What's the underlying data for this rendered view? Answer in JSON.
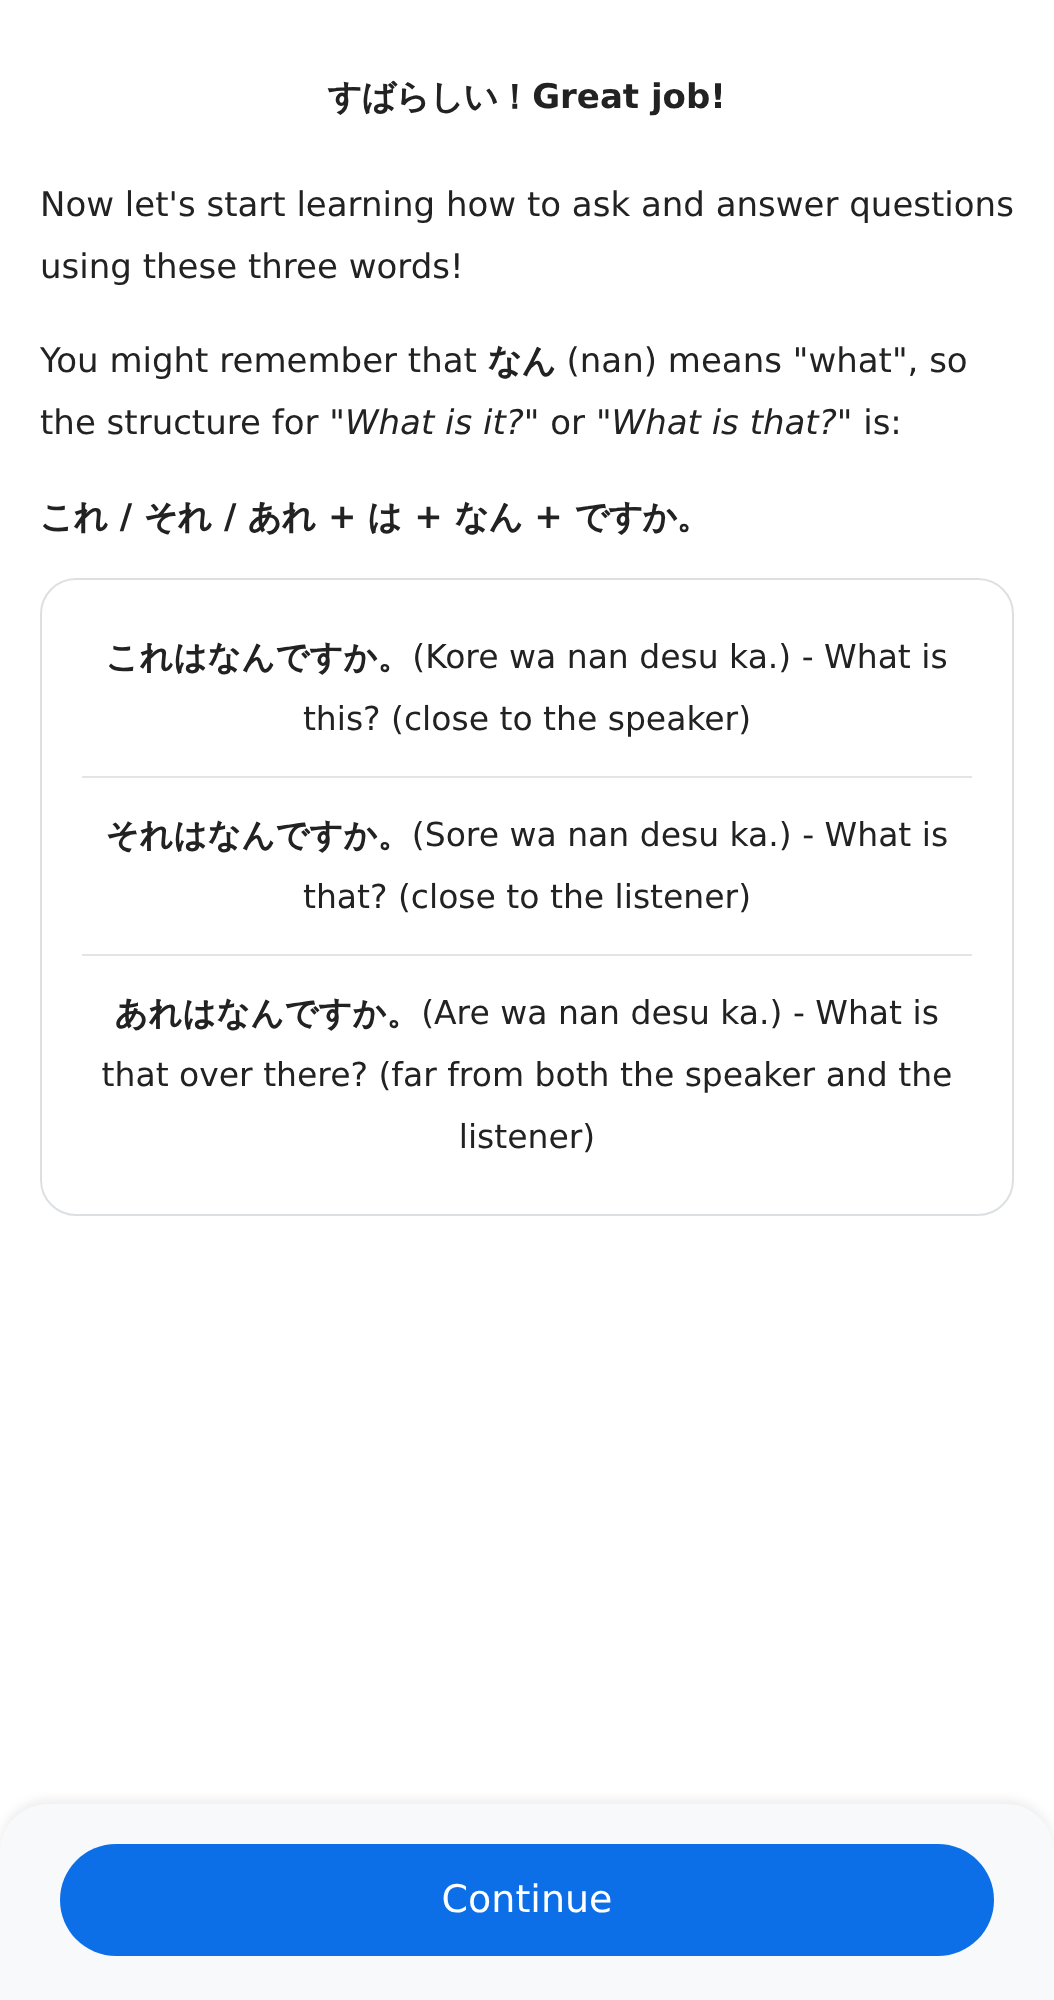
{
  "heading": "すばらしい！Great job!",
  "paragraphs": [
    "Now let's start learning how to ask and answer questions using these three words!",
    "You might remember that **なん** (nan) means \"what\", so the structure for \"*What is it?*\" or \"*What is that?*\" is:"
  ],
  "formula": "これ / それ / あれ + は + なん + ですか。",
  "examples": [
    {
      "text": "**これはなんですか。**(Kore wa nan desu ka.) - What is this? (close to the speaker)"
    },
    {
      "text": "**それはなんですか。**(Sore wa nan desu ka.) - What is that? (close to the listener)"
    },
    {
      "text": "**あれはなんですか。**(Are wa nan desu ka.) - What is that over there? (far from both the speaker and the listener)"
    }
  ],
  "footer": {
    "button": "Continue"
  }
}
